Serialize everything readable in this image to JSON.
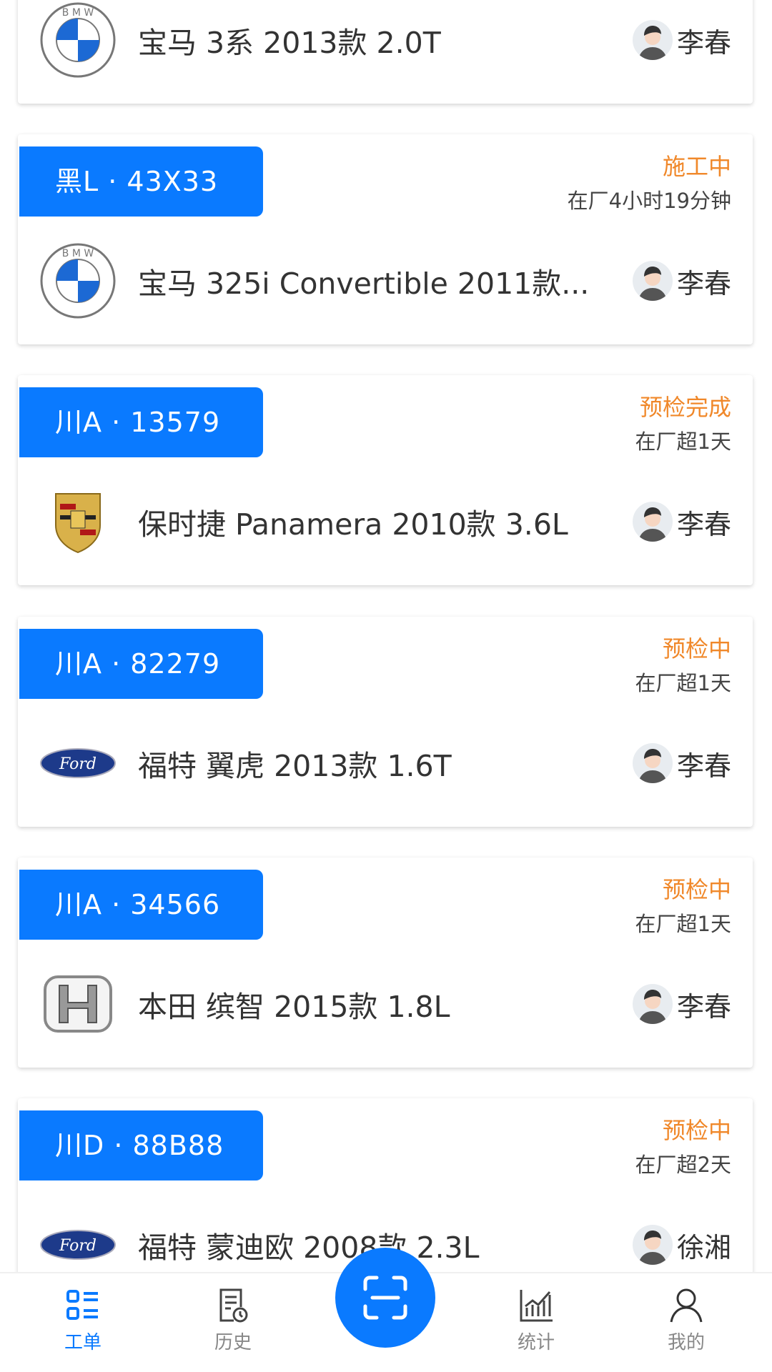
{
  "orders": [
    {
      "plate": "",
      "status": "",
      "time": "",
      "brand": "bmw",
      "car": "宝马 3系 2013款 2.0T",
      "technician": "李春"
    },
    {
      "plate": "黑L · 43X33",
      "status": "施工中",
      "time": "在厂4小时19分钟",
      "brand": "bmw",
      "car": "宝马 325i Convertible 2011款...",
      "technician": "李春"
    },
    {
      "plate": "川A · 13579",
      "status": "预检完成",
      "time": "在厂超1天",
      "brand": "porsche",
      "car": "保时捷 Panamera 2010款 3.6L",
      "technician": "李春"
    },
    {
      "plate": "川A · 82279",
      "status": "预检中",
      "time": "在厂超1天",
      "brand": "ford",
      "car": "福特 翼虎 2013款 1.6T",
      "technician": "李春"
    },
    {
      "plate": "川A · 34566",
      "status": "预检中",
      "time": "在厂超1天",
      "brand": "honda",
      "car": "本田 缤智 2015款 1.8L",
      "technician": "李春"
    },
    {
      "plate": "川D · 88B88",
      "status": "预检中",
      "time": "在厂超2天",
      "brand": "ford",
      "car": "福特 蒙迪欧 2008款 2.3L",
      "technician": "徐湘"
    }
  ],
  "nav": {
    "items": [
      {
        "label": "工单",
        "icon": "list-icon",
        "active": true
      },
      {
        "label": "历史",
        "icon": "history-icon"
      },
      {
        "label": "统计",
        "icon": "chart-icon"
      },
      {
        "label": "我的",
        "icon": "user-icon"
      }
    ],
    "scan_icon": "scan-icon"
  },
  "colors": {
    "accent": "#0a7aff",
    "status": "#f0882a"
  }
}
